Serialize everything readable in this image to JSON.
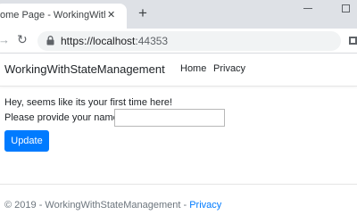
{
  "browser": {
    "tab_title": "ome Page - WorkingWithStateM",
    "close_glyph": "✕",
    "new_tab_glyph": "+",
    "forward_glyph": "→",
    "reload_glyph": "↻",
    "url_scheme_host": "https://localhost",
    "url_port": ":44353"
  },
  "navbar": {
    "brand": "WorkingWithStateManagement",
    "links": [
      "Home",
      "Privacy"
    ]
  },
  "main": {
    "message": "Hey, seems like its your first time here!",
    "prompt_label": "Please provide your name:",
    "name_value": "",
    "button_label": "Update"
  },
  "footer": {
    "text": "© 2019 - WorkingWithStateManagement - ",
    "link": "Privacy"
  },
  "colors": {
    "accent": "#007bff",
    "tabbar": "#dee1e6",
    "omnibox": "#f1f3f4"
  }
}
